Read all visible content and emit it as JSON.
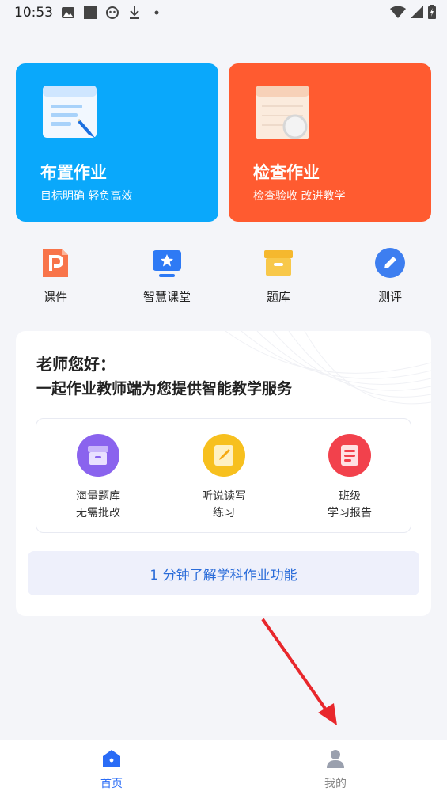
{
  "status_bar": {
    "time": "10:53"
  },
  "cards": [
    {
      "title": "布置作业",
      "subtitle": "目标明确 轻负高效",
      "color": "#0AA8FB"
    },
    {
      "title": "检查作业",
      "subtitle": "检查验收 改进教学",
      "color": "#FF5B30"
    }
  ],
  "quick_nav": [
    {
      "label": "课件",
      "icon": "courseware-icon"
    },
    {
      "label": "智慧课堂",
      "icon": "smart-classroom-icon"
    },
    {
      "label": "题库",
      "icon": "question-bank-icon"
    },
    {
      "label": "测评",
      "icon": "assessment-icon"
    }
  ],
  "promo": {
    "greeting": "老师您好：",
    "subtitle": "一起作业教师端为您提供智能教学服务",
    "features": [
      {
        "line1": "海量题库",
        "line2": "无需批改",
        "icon": "question-bank-purple-icon"
      },
      {
        "line1": "听说读写",
        "line2": "练习",
        "icon": "practice-yellow-icon"
      },
      {
        "line1": "班级",
        "line2": "学习报告",
        "icon": "report-red-icon"
      }
    ],
    "button_label": "1 分钟了解学科作业功能"
  },
  "tab_bar": {
    "tabs": [
      {
        "label": "首页",
        "icon": "home-icon",
        "active": true
      },
      {
        "label": "我的",
        "icon": "profile-icon",
        "active": false
      }
    ],
    "active_color": "#2A6CF6",
    "inactive_color": "#9AA0AE"
  }
}
